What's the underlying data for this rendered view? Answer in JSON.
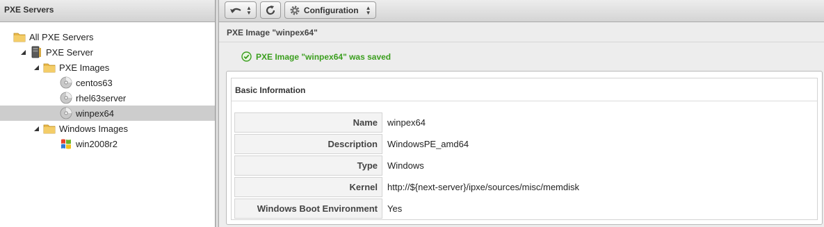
{
  "left_panel": {
    "title": "PXE Servers",
    "tree": [
      {
        "label": "All PXE Servers",
        "icon": "folder-icon"
      },
      {
        "label": "PXE Server",
        "icon": "server-icon",
        "expanded": true
      },
      {
        "label": "PXE Images",
        "icon": "folder-icon",
        "expanded": true
      },
      {
        "label": "centos63",
        "icon": "disc-icon"
      },
      {
        "label": "rhel63server",
        "icon": "disc-icon"
      },
      {
        "label": "winpex64",
        "icon": "disc-icon",
        "selected": true
      },
      {
        "label": "Windows Images",
        "icon": "folder-icon",
        "expanded": true
      },
      {
        "label": "win2008r2",
        "icon": "windows-logo-icon"
      }
    ]
  },
  "toolbar": {
    "back_icon": "undo-icon",
    "reload_icon": "reload-icon",
    "configuration_label": "Configuration",
    "configuration_icon": "gear-icon"
  },
  "main": {
    "title": "PXE Image \"winpex64\"",
    "success_message": "PXE Image \"winpex64\" was saved",
    "success_icon": "checkmark-icon",
    "success_color": "#3a9e1d",
    "basic_info": {
      "title": "Basic Information",
      "rows": [
        {
          "label": "Name",
          "value": "winpex64"
        },
        {
          "label": "Description",
          "value": "WindowsPE_amd64"
        },
        {
          "label": "Type",
          "value": "Windows"
        },
        {
          "label": "Kernel",
          "value": "http://${next-server}/ipxe/sources/misc/memdisk"
        },
        {
          "label": "Windows Boot Environment",
          "value": "Yes"
        }
      ]
    }
  }
}
